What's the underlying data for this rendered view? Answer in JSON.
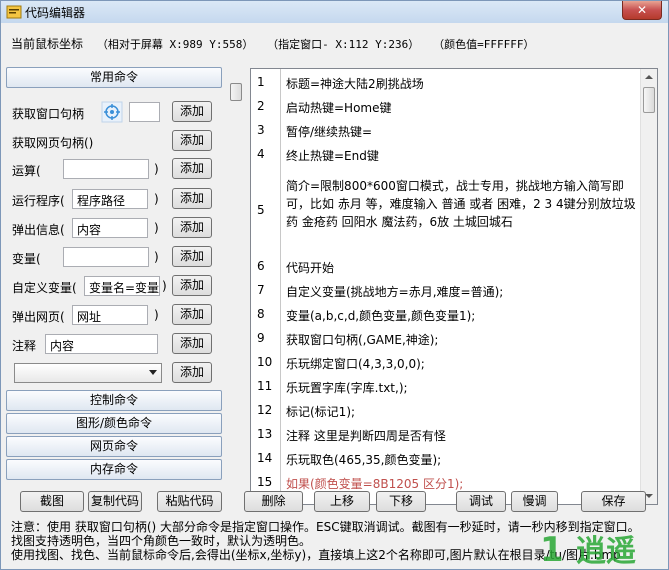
{
  "window": {
    "title": "代码编辑器",
    "close_label": "✕",
    "icon": "app-icon"
  },
  "mouse": {
    "label": "当前鼠标坐标",
    "screen": "（相对于屏幕 X:989 Y:558）",
    "window": "（指定窗口- X:112 Y:236）",
    "color": "（颜色值=FFFFFF）"
  },
  "left": {
    "common_header": "常用命令",
    "rows": [
      {
        "label": "获取窗口句柄",
        "value": "",
        "add": "添加"
      },
      {
        "label": "获取网页句柄()",
        "add": "添加"
      },
      {
        "label": "运算(",
        "value": "",
        "close": ")",
        "add": "添加"
      },
      {
        "label": "运行程序(",
        "value": "程序路径",
        "close": ")",
        "add": "添加"
      },
      {
        "label": "弹出信息(",
        "value": "内容",
        "close": ")",
        "add": "添加"
      },
      {
        "label": "变量(",
        "value": "",
        "close": ")",
        "add": "添加"
      },
      {
        "label": "自定义变量(",
        "value": "变量名=变量",
        "close": ")",
        "add": "添加"
      },
      {
        "label": "弹出网页(",
        "value": "网址",
        "close": ")",
        "add": "添加"
      },
      {
        "label": "注释",
        "value": "内容",
        "add": "添加"
      },
      {
        "select_value": "",
        "add": "添加"
      }
    ],
    "sections": [
      "控制命令",
      "图形/颜色命令",
      "网页命令",
      "内存命令"
    ]
  },
  "editor": {
    "lines": [
      {
        "num": "1",
        "text": "标题=神途大陆2刷挑战场"
      },
      {
        "num": "2",
        "text": "启动热键=Home键"
      },
      {
        "num": "3",
        "text": "暂停/继续热键="
      },
      {
        "num": "4",
        "text": "终止热键=End键"
      },
      {
        "num": "5",
        "text": "简介=限制800*600窗口模式，战士专用，挑战地方输入简写即可，比如 赤月 等，难度输入 普通 或者 困难，2 3 4键分别放垃圾药 金疮药 回阳水 魔法药，6放 土城回城石"
      },
      {
        "num": "6",
        "text": "代码开始"
      },
      {
        "num": "7",
        "text": "自定义变量(挑战地方=赤月,难度=普通);"
      },
      {
        "num": "8",
        "text": "变量(a,b,c,d,颜色变量,颜色变量1);"
      },
      {
        "num": "9",
        "text": "获取窗口句柄(,GAME,神途);"
      },
      {
        "num": "10",
        "text": "乐玩绑定窗口(4,3,3,0,0);"
      },
      {
        "num": "11",
        "text": "乐玩置字库(字库.txt,);"
      },
      {
        "num": "12",
        "text": "标记(标记1);"
      },
      {
        "num": "13",
        "text": "注释 这里是判断四周是否有怪"
      },
      {
        "num": "14",
        "text": "乐玩取色(465,35,颜色变量);"
      },
      {
        "num": "15",
        "text": "如果(颜色变量=8B1205 区分1);"
      }
    ]
  },
  "toolbar": {
    "buttons": [
      "截图",
      "复制代码",
      "粘贴代码",
      "删除",
      "上移",
      "下移",
      "调试",
      "慢调",
      "保存"
    ]
  },
  "notes": {
    "line1": "注意：使用 获取窗口句柄() 大部分命令是指定窗口操作。ESC键取消调试。截图有一秒延时，请一秒内移到指定窗口。",
    "line2": "找图支持透明色，当四个角颜色一致时，默认为透明色。",
    "line3": "使用找图、找色、当前鼠标命令后,会得出(坐标x,坐标y)，直接填上这2个名称即可,图片默认在根目录/tu/图片.bmp"
  },
  "watermark": {
    "text": "1 逍遥"
  },
  "colors": {
    "line15": "#c0504d",
    "watermark": "#2aa836"
  }
}
